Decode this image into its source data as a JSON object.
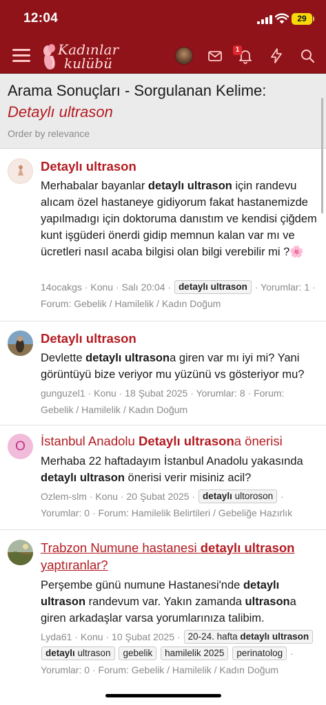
{
  "status_bar": {
    "time": "12:04",
    "battery": "29"
  },
  "header": {
    "logo_line1": "Kadınlar",
    "logo_line2": "kulübü",
    "notification_count": "1"
  },
  "search": {
    "heading": "Arama Sonuçları - Sorgulanan Kelime:",
    "query": "Detaylı ultrason",
    "order": "Order by relevance"
  },
  "results": [
    {
      "title": "Detaylı ultrason",
      "snippet_parts": [
        "Merhabalar bayanlar ",
        "detaylı ultrason",
        " için randevu alıcam özel hastaneye gidiyorum fakat hastanemizde yapılmadıgı için doktoruma danıstım ve kendisi çiğdem kunt işgüderi önerdi gidip memnun kalan var mı ve ücretleri nasıl acaba bilgisi olan bilgi verebilir mi ?",
        "🌸"
      ],
      "author": "14ocakgs",
      "type": "Konu",
      "date": "Salı 20:04",
      "tags": [
        "detaylı ultrason"
      ],
      "comments_label": "Yorumlar:",
      "comments": "1",
      "forum_label": "Forum:",
      "forum": "Gebelik / Hamilelik / Kadın Doğum"
    },
    {
      "title": "Detaylı ultrason",
      "snippet_parts": [
        "Devlette ",
        "detaylı ultrason",
        "a giren var mı iyi mi? Yani görüntüyü bize veriyor mu yüzünü vs gösteriyor mu?"
      ],
      "author": "gunguzel1",
      "type": "Konu",
      "date": "18 Şubat 2025",
      "comments_label": "Yorumlar:",
      "comments": "8",
      "forum_label": "Forum:",
      "forum": "Gebelik / Hamilelik / Kadın Doğum"
    },
    {
      "title_parts": [
        "İstanbul Anadolu ",
        "Detaylı ultrason",
        "a önerisi"
      ],
      "snippet_parts": [
        "Merhaba 22 haftadayım İstanbul Anadolu yakasında ",
        "detaylı ultrason",
        " önerisi verir misiniz acil?"
      ],
      "avatar_letter": "O",
      "author": "Ozlem-slm",
      "type": "Konu",
      "date": "20 Şubat 2025",
      "tag_parts": [
        "detaylı",
        " ultoroson"
      ],
      "comments_label": "Yorumlar:",
      "comments": "0",
      "forum_label": "Forum:",
      "forum": "Hamilelik Belirtileri / Gebeliğe Hazırlık"
    },
    {
      "title_parts": [
        "Trabzon Numune hastanesi ",
        "detaylı ultrason",
        " yaptıranlar?"
      ],
      "snippet_parts": [
        "Perşembe günü numune Hastanesi'nde ",
        "detaylı ultrason",
        " randevum var. Yakın zamanda ",
        "ultrason",
        "a giren arkadaşlar varsa yorumlarınıza talibim."
      ],
      "author": "Lyda61",
      "type": "Konu",
      "date": "10 Şubat 2025",
      "tag1_parts": [
        "20-24. hafta ",
        "detaylı ultrason"
      ],
      "tag2_parts": [
        "detaylı",
        " ultrason"
      ],
      "tags_rest": [
        "gebelik",
        "hamilelik 2025",
        "perinatolog"
      ],
      "comments_label": "Yorumlar:",
      "comments": "0",
      "forum_label": "Forum:",
      "forum": "Gebelik / Hamilelik / Kadın Doğum"
    }
  ],
  "colors": {
    "header_bg": "#8f1319",
    "accent_red": "#b31b21",
    "meta_gray": "#8a8a8a"
  }
}
